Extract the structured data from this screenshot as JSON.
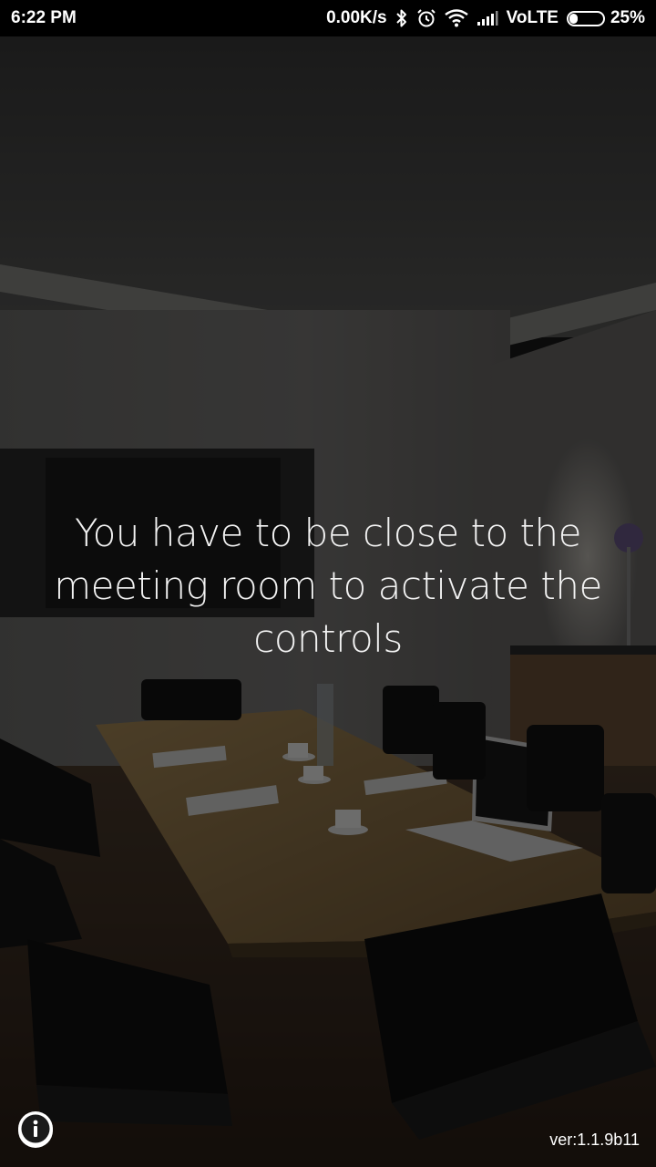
{
  "status_bar": {
    "time": "6:22 PM",
    "network_speed": "0.00K/s",
    "network_type": "VoLTE",
    "battery_percent": "25%",
    "battery_level": 0.25,
    "icons": [
      "bluetooth-icon",
      "alarm-icon",
      "wifi-icon",
      "signal-icon",
      "battery-icon"
    ]
  },
  "main": {
    "message": "You have to be close to the meeting room to activate the controls",
    "background": "meeting-room-photo"
  },
  "footer": {
    "info_icon": "info-icon",
    "version": "ver:1.1.9b11"
  },
  "colors": {
    "status_bar_bg": "#000000",
    "overlay": "#000000",
    "text": "#f2f2f2"
  }
}
